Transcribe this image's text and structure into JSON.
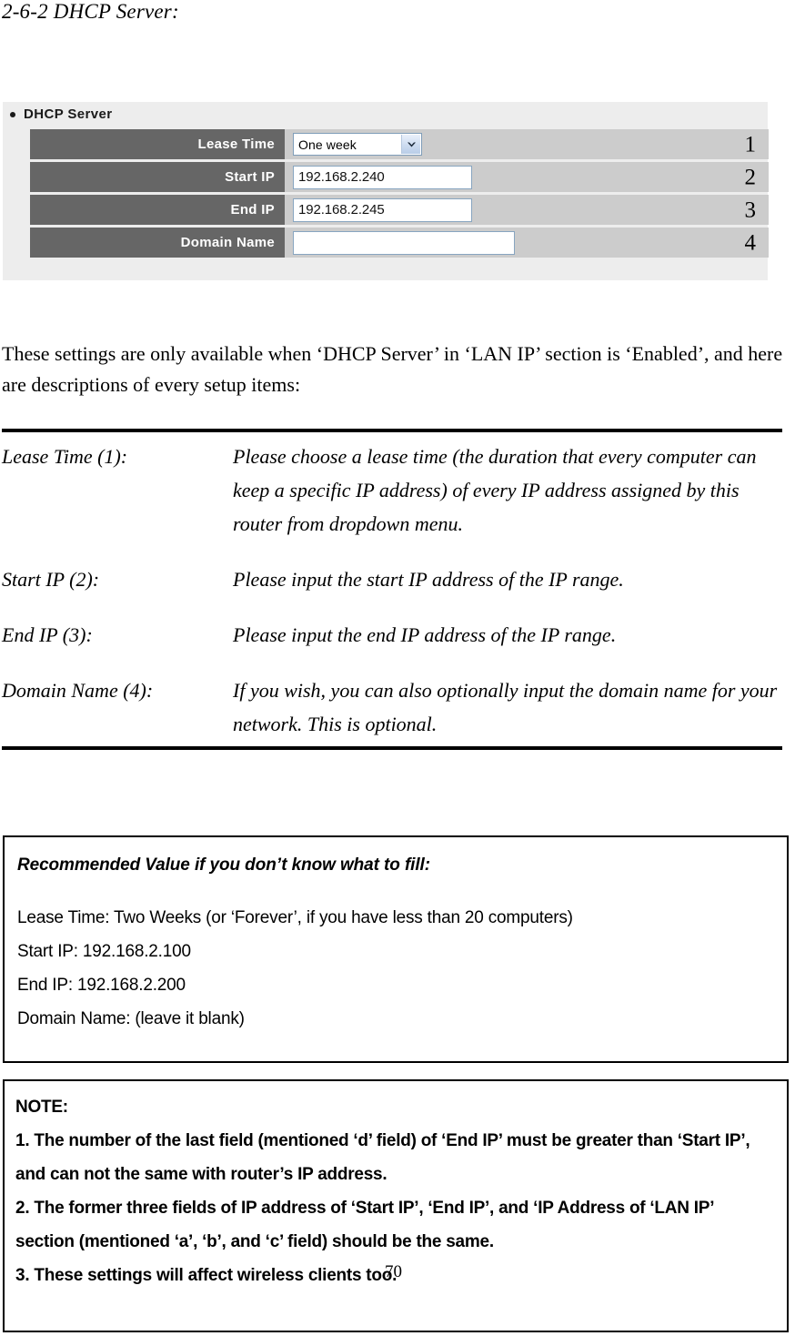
{
  "document": {
    "section_title": "2-6-2 DHCP Server:",
    "page_number": "70"
  },
  "ui_panel": {
    "heading": "DHCP Server",
    "rows": [
      {
        "label": "Lease Time",
        "control": "select",
        "value": "One week",
        "callout": "1"
      },
      {
        "label": "Start IP",
        "control": "text",
        "value": "192.168.2.240",
        "callout": "2"
      },
      {
        "label": "End IP",
        "control": "text",
        "value": "192.168.2.245",
        "callout": "3"
      },
      {
        "label": "Domain Name",
        "control": "text",
        "value": "",
        "callout": "4"
      }
    ],
    "colors": {
      "panel_background": "#ededed",
      "label_cell": "#666666",
      "value_cell": "#cccccc",
      "input_border": "#88a5c0",
      "select_border": "#7f9db9"
    }
  },
  "intro_paragraph": "These settings are only available when ‘DHCP Server’ in ‘LAN IP’ section is ‘Enabled’, and here are descriptions of every setup items:",
  "definitions": [
    {
      "term": "Lease Time (1):",
      "description": "Please choose a lease time (the duration that every computer can keep a specific IP address) of every IP address assigned by this router from dropdown menu."
    },
    {
      "term": "Start IP (2):",
      "description": "Please input the start IP address of the IP range."
    },
    {
      "term": "End IP (3):",
      "description": "Please input the end IP address of the IP range."
    },
    {
      "term": "Domain Name (4):",
      "description": "If you wish, you can also optionally input the domain name for your network. This is optional."
    }
  ],
  "recommended_box": {
    "heading": "Recommended Value if you don’t know what to fill:",
    "lines": [
      "Lease Time: Two Weeks (or ‘Forever’, if you have less than 20 computers)",
      "Start IP: 192.168.2.100",
      "End IP: 192.168.2.200",
      "Domain Name: (leave it blank)"
    ]
  },
  "note_box": {
    "heading": "NOTE:",
    "lines": [
      "1. The number of the last field (mentioned ‘d’ field) of ‘End IP’ must be greater than ‘Start IP’, and can not the same with router’s IP address.",
      "2. The former three fields of IP address of ‘Start IP’, ‘End IP’, and ‘IP Address of ‘LAN IP’ section (mentioned ‘a’, ‘b’, and ‘c’ field) should be the same.",
      "3. These settings will affect wireless clients too."
    ]
  }
}
